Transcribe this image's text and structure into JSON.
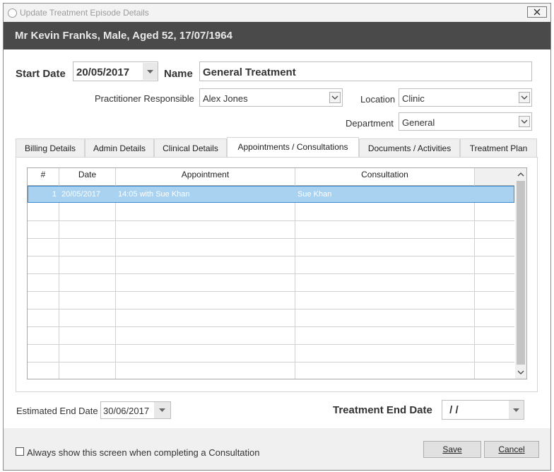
{
  "window": {
    "title": "Update Treatment Episode Details",
    "close_label": "⨯"
  },
  "patient": {
    "summary": "Mr Kevin Franks, Male, Aged 52, 17/07/1964"
  },
  "form": {
    "start_date_label": "Start Date",
    "start_date_value": "20/05/2017",
    "name_label": "Name",
    "name_value": "General Treatment",
    "practitioner_label": "Practitioner Responsible",
    "practitioner_value": "Alex Jones",
    "location_label": "Location",
    "location_value": "Clinic",
    "department_label": "Department",
    "department_value": "General"
  },
  "tabs": [
    {
      "label": "Billing Details",
      "active": false
    },
    {
      "label": "Admin Details",
      "active": false
    },
    {
      "label": "Clinical Details",
      "active": false
    },
    {
      "label": "Appointments / Consultations",
      "active": true
    },
    {
      "label": "Documents / Activities",
      "active": false
    },
    {
      "label": "Treatment Plan",
      "active": false
    }
  ],
  "table": {
    "columns": [
      "#",
      "Date",
      "Appointment",
      "Consultation"
    ],
    "rows": [
      {
        "num": "1",
        "date": "20/05/2017",
        "appointment": "14:05 with Sue Khan",
        "consultation": "Sue Khan"
      }
    ]
  },
  "footer": {
    "estimated_end_label": "Estimated End Date",
    "estimated_end_value": "30/06/2017",
    "treatment_end_label": "Treatment End Date",
    "treatment_end_value": " / /",
    "always_show_label": "Always show this screen when completing a Consultation",
    "save_label": "Save",
    "cancel_label": "Cancel"
  },
  "colors": {
    "patient_bar": "#4a4a4a",
    "selection": "#a8d2f0",
    "selection_border": "#3a8ad0"
  }
}
